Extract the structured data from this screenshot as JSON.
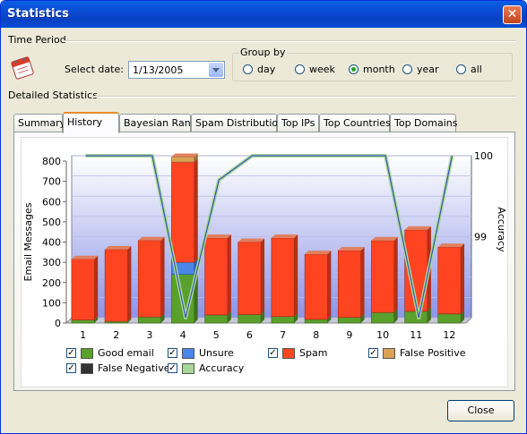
{
  "window": {
    "title": "Statistics",
    "close_glyph": "✕"
  },
  "time_period": {
    "label": "Time Period",
    "select_date_label": "Select date:",
    "date_value": "1/13/2005"
  },
  "group_by": {
    "label": "Group by",
    "options": [
      {
        "label": "day",
        "selected": false
      },
      {
        "label": "week",
        "selected": false
      },
      {
        "label": "month",
        "selected": true
      },
      {
        "label": "year",
        "selected": false
      },
      {
        "label": "all",
        "selected": false
      }
    ]
  },
  "detailed_statistics": {
    "label": "Detailed Statistics"
  },
  "tabs": [
    {
      "label": "Summary",
      "active": false
    },
    {
      "label": "History",
      "active": true
    },
    {
      "label": "Bayesian Rank",
      "active": false
    },
    {
      "label": "Spam Distribution",
      "active": false
    },
    {
      "label": "Top IPs",
      "active": false
    },
    {
      "label": "Top Countries",
      "active": false
    },
    {
      "label": "Top Domains",
      "active": false
    }
  ],
  "buttons": {
    "close": "Close"
  },
  "chart_data": {
    "type": "bar",
    "stacked": true,
    "categories": [
      "1",
      "2",
      "3",
      "4",
      "5",
      "6",
      "7",
      "8",
      "9",
      "10",
      "11",
      "12"
    ],
    "ylabel": "Email Messages",
    "y2label": "Accuracy",
    "ylim": [
      0,
      800
    ],
    "y_ticks": [
      "0",
      "100",
      "200",
      "300",
      "400",
      "500",
      "600",
      "700",
      "800"
    ],
    "y2_ticks": [
      "99",
      "100"
    ],
    "y2lim": [
      98,
      100
    ],
    "series": [
      {
        "name": "Good email",
        "color": "#5aa02c",
        "values": [
          15,
          8,
          30,
          240,
          40,
          42,
          32,
          18,
          28,
          52,
          58,
          45
        ]
      },
      {
        "name": "Unsure",
        "color": "#4a86e8",
        "values": [
          0,
          0,
          0,
          60,
          0,
          0,
          0,
          0,
          0,
          0,
          0,
          0
        ]
      },
      {
        "name": "Spam",
        "color": "#ff4422",
        "values": [
          300,
          355,
          378,
          495,
          380,
          358,
          388,
          322,
          330,
          355,
          402,
          330
        ]
      },
      {
        "name": "False Positive",
        "color": "#d9a255",
        "values": [
          0,
          0,
          0,
          25,
          0,
          0,
          0,
          0,
          0,
          0,
          0,
          0
        ]
      },
      {
        "name": "False Negative",
        "color": "#333333",
        "values": [
          0,
          0,
          0,
          0,
          0,
          0,
          0,
          0,
          0,
          0,
          0,
          0
        ]
      }
    ],
    "accuracy": {
      "name": "Accuracy",
      "color": "#a8d898",
      "values": [
        100,
        100,
        100,
        98,
        99.7,
        100,
        100,
        100,
        100,
        100,
        98,
        100
      ]
    },
    "legend": [
      {
        "label": "Good email",
        "color": "#5aa02c",
        "checked": true
      },
      {
        "label": "Unsure",
        "color": "#4a86e8",
        "checked": true
      },
      {
        "label": "Spam",
        "color": "#ff4422",
        "checked": true
      },
      {
        "label": "False Positive",
        "color": "#d9a255",
        "checked": true
      },
      {
        "label": "False Negative",
        "color": "#333333",
        "checked": true
      },
      {
        "label": "Accuracy",
        "color": "#a8d898",
        "checked": true
      }
    ]
  }
}
